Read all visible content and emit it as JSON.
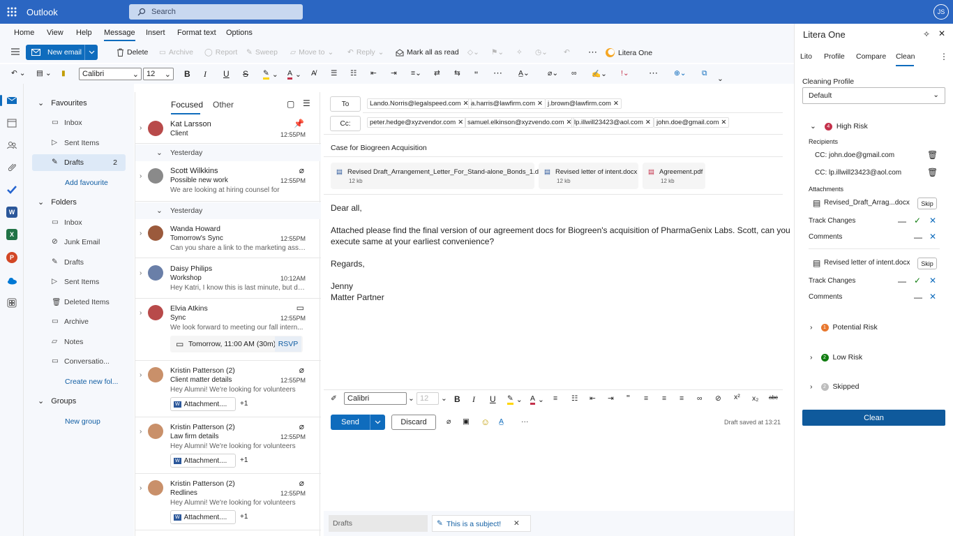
{
  "app": {
    "name": "Outlook",
    "user_initials": "JS"
  },
  "search": {
    "placeholder": "Search"
  },
  "ribbon_tabs": [
    "Home",
    "View",
    "Help",
    "Message",
    "Insert",
    "Format text",
    "Options"
  ],
  "toolbar": {
    "new_email": "New email",
    "delete": "Delete",
    "archive": "Archive",
    "report": "Report",
    "sweep": "Sweep",
    "move_to": "Move to",
    "reply": "Reply",
    "mark_all_read": "Mark all as read",
    "litera_one": "Litera One",
    "more": "⋯"
  },
  "format_toolbar": {
    "font": "Calibri",
    "size": "12"
  },
  "nav": {
    "favourites_label": "Favourites",
    "favourites": [
      {
        "label": "Inbox",
        "count": ""
      },
      {
        "label": "Sent Items",
        "count": ""
      },
      {
        "label": "Drafts",
        "count": "2"
      }
    ],
    "add_favourite": "Add favourite",
    "folders_label": "Folders",
    "folders": [
      "Inbox",
      "Junk Email",
      "Drafts",
      "Sent Items",
      "Deleted Items",
      "Archive",
      "Notes",
      "Conversatio..."
    ],
    "create_folder": "Create new fol...",
    "groups_label": "Groups",
    "new_group": "New group"
  },
  "list": {
    "tab_focused": "Focused",
    "tab_other": "Other",
    "yesterday": "Yesterday",
    "messages": [
      {
        "from": "Kat Larsson",
        "subject": "Client",
        "preview": "",
        "time": "12:55PM"
      },
      {
        "from": "Scott Wilkkins",
        "subject": "Possible new work",
        "preview": "We are looking at hiring counsel for",
        "time": "12:55PM"
      },
      {
        "from": "Wanda Howard",
        "subject": "Tomorrow's Sync",
        "preview": "Can you share a link to the marketing asse...",
        "time": "12:55PM"
      },
      {
        "from": "Daisy Philips",
        "subject": "Workshop",
        "preview": "Hey Katri, I know this is last minute, but do...",
        "time": "10:12AM"
      },
      {
        "from": "Elvia Atkins",
        "subject": "Sync",
        "preview": "We look forward to meeting our fall intern...",
        "time": "12:55PM"
      },
      {
        "from": "Kristin Patterson (2)",
        "subject": "Client matter details",
        "preview": "Hey Alumni! We're looking for volunteers",
        "time": "12:55PM"
      },
      {
        "from": "Kristin Patterson (2)",
        "subject": "Law firm details",
        "preview": "Hey Alumni! We're looking for volunteers",
        "time": "12:55PM"
      },
      {
        "from": "Kristin Patterson (2)",
        "subject": "Redlines",
        "preview": "Hey Alumni! We're looking for volunteers",
        "time": "12:55PM"
      }
    ],
    "meeting": {
      "when": "Tomorrow, 11:00 AM (30m)",
      "rsvp": "RSVP"
    },
    "attachment_label": "Attachment....",
    "attachment_more": "+1"
  },
  "compose": {
    "to_label": "To",
    "cc_label": "Cc:",
    "to": [
      "Lando.Norris@legalspeed.com",
      "a.harris@lawfirm.com",
      "j.brown@lawfirm.com"
    ],
    "cc": [
      "peter.hedge@xyzvendor.com",
      "samuel.elkinson@xyzvendo.com",
      "lp.illwill23423@aol.com",
      "john.doe@gmail.com"
    ],
    "subject": "Case for Biogreen Acquisition",
    "attachments": [
      {
        "name": "Revised Draft_Arrangement_Letter_For_Stand-alone_Bonds_1.docx",
        "size": "12 kb"
      },
      {
        "name": "Revised letter of intent.docx",
        "size": "12 kb"
      },
      {
        "name": "Agreement.pdf",
        "size": "12 kb"
      }
    ],
    "body": {
      "greeting": "Dear all,",
      "line1": "Attached please find the final version of our agreement docs for Biogreen's acquisition of PharmaGenix Labs.  Scott, can you",
      "line2": "execute same at your earliest convenience?",
      "regards": "Regards,",
      "name": "Jenny",
      "title": "Matter Partner"
    },
    "font": "Calibri",
    "size": "12",
    "send": "Send",
    "discard": "Discard",
    "more": "···",
    "draft_saved": "Draft saved at 13:21"
  },
  "footer": {
    "drafts": "Drafts",
    "subject_tab": "This is a subject!"
  },
  "panel": {
    "title": "Litera One",
    "tabs": [
      "Lito",
      "Profile",
      "Compare",
      "Clean"
    ],
    "cleaning_profile_label": "Cleaning Profile",
    "profile": "Default",
    "high_risk": {
      "label": "High Risk",
      "count": "4"
    },
    "recipients_label": "Recipients",
    "recipients": [
      "CC: john.doe@gmail.com",
      "CC: lp.illwill23423@aol.com"
    ],
    "attachments_label": "Attachments",
    "files": [
      "Revised_Draft_Arrag...docx",
      "Revised letter of intent.docx"
    ],
    "skip": "Skip",
    "track_changes": "Track Changes",
    "comments": "Comments",
    "potential_risk": {
      "label": "Potential Risk",
      "count": "1"
    },
    "low_risk": {
      "label": "Low Risk",
      "count": "2"
    },
    "skipped": {
      "label": "Skipped",
      "count": "2"
    },
    "clean": "Clean"
  },
  "colors": {
    "brand": "#2b66c2",
    "accent": "#0f6cbd",
    "high": "#c4314b",
    "potential": "#e8772e",
    "low": "#107c10",
    "skipped": "#bdbdbd"
  }
}
